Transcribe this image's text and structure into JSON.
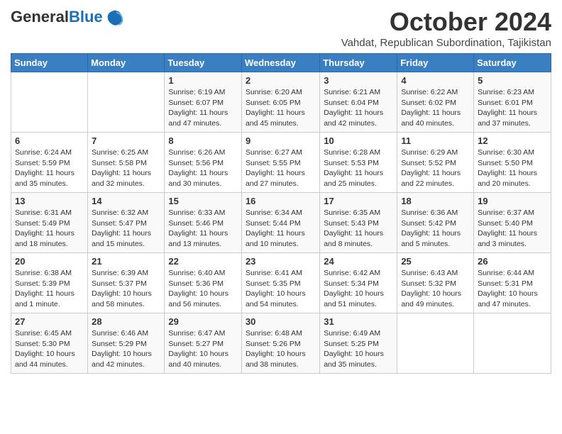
{
  "header": {
    "logo_general": "General",
    "logo_blue": "Blue",
    "month_title": "October 2024",
    "subtitle": "Vahdat, Republican Subordination, Tajikistan"
  },
  "days_of_week": [
    "Sunday",
    "Monday",
    "Tuesday",
    "Wednesday",
    "Thursday",
    "Friday",
    "Saturday"
  ],
  "weeks": [
    [
      {
        "day": "",
        "info": ""
      },
      {
        "day": "",
        "info": ""
      },
      {
        "day": "1",
        "info": "Sunrise: 6:19 AM\nSunset: 6:07 PM\nDaylight: 11 hours and 47 minutes."
      },
      {
        "day": "2",
        "info": "Sunrise: 6:20 AM\nSunset: 6:05 PM\nDaylight: 11 hours and 45 minutes."
      },
      {
        "day": "3",
        "info": "Sunrise: 6:21 AM\nSunset: 6:04 PM\nDaylight: 11 hours and 42 minutes."
      },
      {
        "day": "4",
        "info": "Sunrise: 6:22 AM\nSunset: 6:02 PM\nDaylight: 11 hours and 40 minutes."
      },
      {
        "day": "5",
        "info": "Sunrise: 6:23 AM\nSunset: 6:01 PM\nDaylight: 11 hours and 37 minutes."
      }
    ],
    [
      {
        "day": "6",
        "info": "Sunrise: 6:24 AM\nSunset: 5:59 PM\nDaylight: 11 hours and 35 minutes."
      },
      {
        "day": "7",
        "info": "Sunrise: 6:25 AM\nSunset: 5:58 PM\nDaylight: 11 hours and 32 minutes."
      },
      {
        "day": "8",
        "info": "Sunrise: 6:26 AM\nSunset: 5:56 PM\nDaylight: 11 hours and 30 minutes."
      },
      {
        "day": "9",
        "info": "Sunrise: 6:27 AM\nSunset: 5:55 PM\nDaylight: 11 hours and 27 minutes."
      },
      {
        "day": "10",
        "info": "Sunrise: 6:28 AM\nSunset: 5:53 PM\nDaylight: 11 hours and 25 minutes."
      },
      {
        "day": "11",
        "info": "Sunrise: 6:29 AM\nSunset: 5:52 PM\nDaylight: 11 hours and 22 minutes."
      },
      {
        "day": "12",
        "info": "Sunrise: 6:30 AM\nSunset: 5:50 PM\nDaylight: 11 hours and 20 minutes."
      }
    ],
    [
      {
        "day": "13",
        "info": "Sunrise: 6:31 AM\nSunset: 5:49 PM\nDaylight: 11 hours and 18 minutes."
      },
      {
        "day": "14",
        "info": "Sunrise: 6:32 AM\nSunset: 5:47 PM\nDaylight: 11 hours and 15 minutes."
      },
      {
        "day": "15",
        "info": "Sunrise: 6:33 AM\nSunset: 5:46 PM\nDaylight: 11 hours and 13 minutes."
      },
      {
        "day": "16",
        "info": "Sunrise: 6:34 AM\nSunset: 5:44 PM\nDaylight: 11 hours and 10 minutes."
      },
      {
        "day": "17",
        "info": "Sunrise: 6:35 AM\nSunset: 5:43 PM\nDaylight: 11 hours and 8 minutes."
      },
      {
        "day": "18",
        "info": "Sunrise: 6:36 AM\nSunset: 5:42 PM\nDaylight: 11 hours and 5 minutes."
      },
      {
        "day": "19",
        "info": "Sunrise: 6:37 AM\nSunset: 5:40 PM\nDaylight: 11 hours and 3 minutes."
      }
    ],
    [
      {
        "day": "20",
        "info": "Sunrise: 6:38 AM\nSunset: 5:39 PM\nDaylight: 11 hours and 1 minute."
      },
      {
        "day": "21",
        "info": "Sunrise: 6:39 AM\nSunset: 5:37 PM\nDaylight: 10 hours and 58 minutes."
      },
      {
        "day": "22",
        "info": "Sunrise: 6:40 AM\nSunset: 5:36 PM\nDaylight: 10 hours and 56 minutes."
      },
      {
        "day": "23",
        "info": "Sunrise: 6:41 AM\nSunset: 5:35 PM\nDaylight: 10 hours and 54 minutes."
      },
      {
        "day": "24",
        "info": "Sunrise: 6:42 AM\nSunset: 5:34 PM\nDaylight: 10 hours and 51 minutes."
      },
      {
        "day": "25",
        "info": "Sunrise: 6:43 AM\nSunset: 5:32 PM\nDaylight: 10 hours and 49 minutes."
      },
      {
        "day": "26",
        "info": "Sunrise: 6:44 AM\nSunset: 5:31 PM\nDaylight: 10 hours and 47 minutes."
      }
    ],
    [
      {
        "day": "27",
        "info": "Sunrise: 6:45 AM\nSunset: 5:30 PM\nDaylight: 10 hours and 44 minutes."
      },
      {
        "day": "28",
        "info": "Sunrise: 6:46 AM\nSunset: 5:29 PM\nDaylight: 10 hours and 42 minutes."
      },
      {
        "day": "29",
        "info": "Sunrise: 6:47 AM\nSunset: 5:27 PM\nDaylight: 10 hours and 40 minutes."
      },
      {
        "day": "30",
        "info": "Sunrise: 6:48 AM\nSunset: 5:26 PM\nDaylight: 10 hours and 38 minutes."
      },
      {
        "day": "31",
        "info": "Sunrise: 6:49 AM\nSunset: 5:25 PM\nDaylight: 10 hours and 35 minutes."
      },
      {
        "day": "",
        "info": ""
      },
      {
        "day": "",
        "info": ""
      }
    ]
  ]
}
